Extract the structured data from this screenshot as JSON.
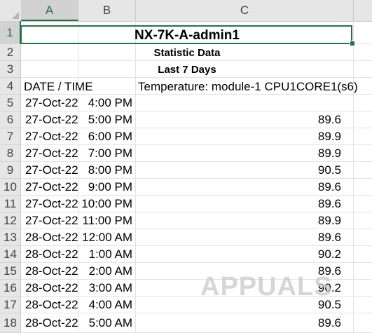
{
  "columns": [
    "A",
    "B",
    "C"
  ],
  "rows": [
    "1",
    "2",
    "3",
    "4",
    "5",
    "6",
    "7",
    "8",
    "9",
    "10",
    "11",
    "12",
    "13",
    "14",
    "15",
    "16",
    "17",
    "18"
  ],
  "cells": {
    "title": "NX-7K-A-admin1",
    "subtitle": "Statistic Data",
    "period": "Last 7 Days",
    "header_date": "DATE / TIME",
    "header_temp": "Temperature: module-1 CPU1CORE1(s6)"
  },
  "data_rows": [
    {
      "date": "27-Oct-22",
      "time": "4:00 PM",
      "value": ""
    },
    {
      "date": "27-Oct-22",
      "time": "5:00 PM",
      "value": "89.6"
    },
    {
      "date": "27-Oct-22",
      "time": "6:00 PM",
      "value": "89.9"
    },
    {
      "date": "27-Oct-22",
      "time": "7:00 PM",
      "value": "89.9"
    },
    {
      "date": "27-Oct-22",
      "time": "8:00 PM",
      "value": "90.5"
    },
    {
      "date": "27-Oct-22",
      "time": "9:00 PM",
      "value": "89.6"
    },
    {
      "date": "27-Oct-22",
      "time": "10:00 PM",
      "value": "89.6"
    },
    {
      "date": "27-Oct-22",
      "time": "11:00 PM",
      "value": "89.9"
    },
    {
      "date": "28-Oct-22",
      "time": "12:00 AM",
      "value": "89.6"
    },
    {
      "date": "28-Oct-22",
      "time": "1:00 AM",
      "value": "90.2"
    },
    {
      "date": "28-Oct-22",
      "time": "2:00 AM",
      "value": "89.6"
    },
    {
      "date": "28-Oct-22",
      "time": "3:00 AM",
      "value": "90.2"
    },
    {
      "date": "28-Oct-22",
      "time": "4:00 AM",
      "value": "90.5"
    },
    {
      "date": "28-Oct-22",
      "time": "5:00 AM",
      "value": "89.6"
    }
  ],
  "watermark": "APPUALS",
  "colors": {
    "accent": "#217346",
    "header_bg": "#e6e6e6"
  }
}
